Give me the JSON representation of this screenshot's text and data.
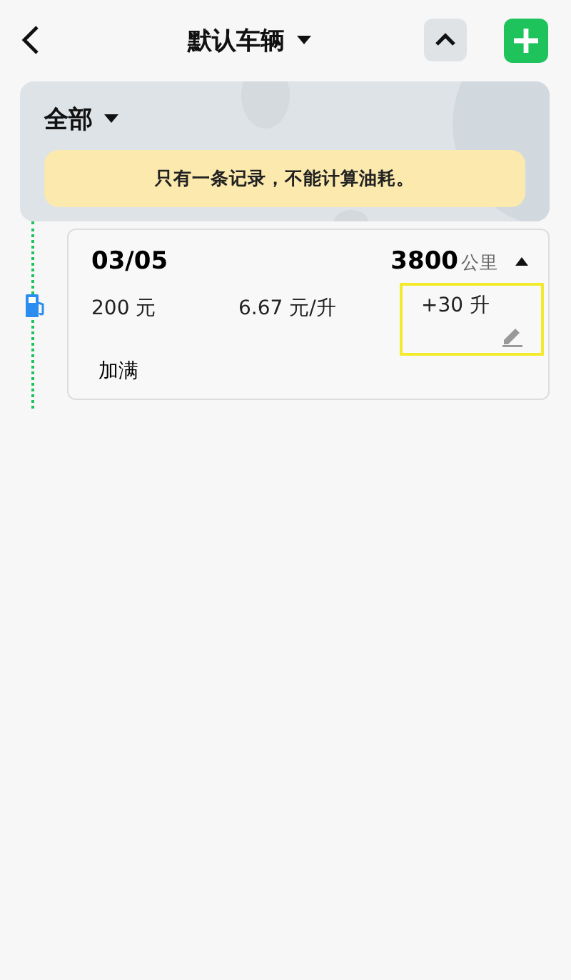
{
  "header": {
    "title": "默认车辆"
  },
  "filter": {
    "label": "全部",
    "notice": "只有一条记录，不能计算油耗。"
  },
  "records": [
    {
      "date": "03/05",
      "odometer": "3800",
      "unit": "公里",
      "expanded": true,
      "amount": "200 元",
      "price": "6.67 元/升",
      "volume": "+30 升",
      "volume_highlighted": true,
      "note": "加满"
    }
  ]
}
